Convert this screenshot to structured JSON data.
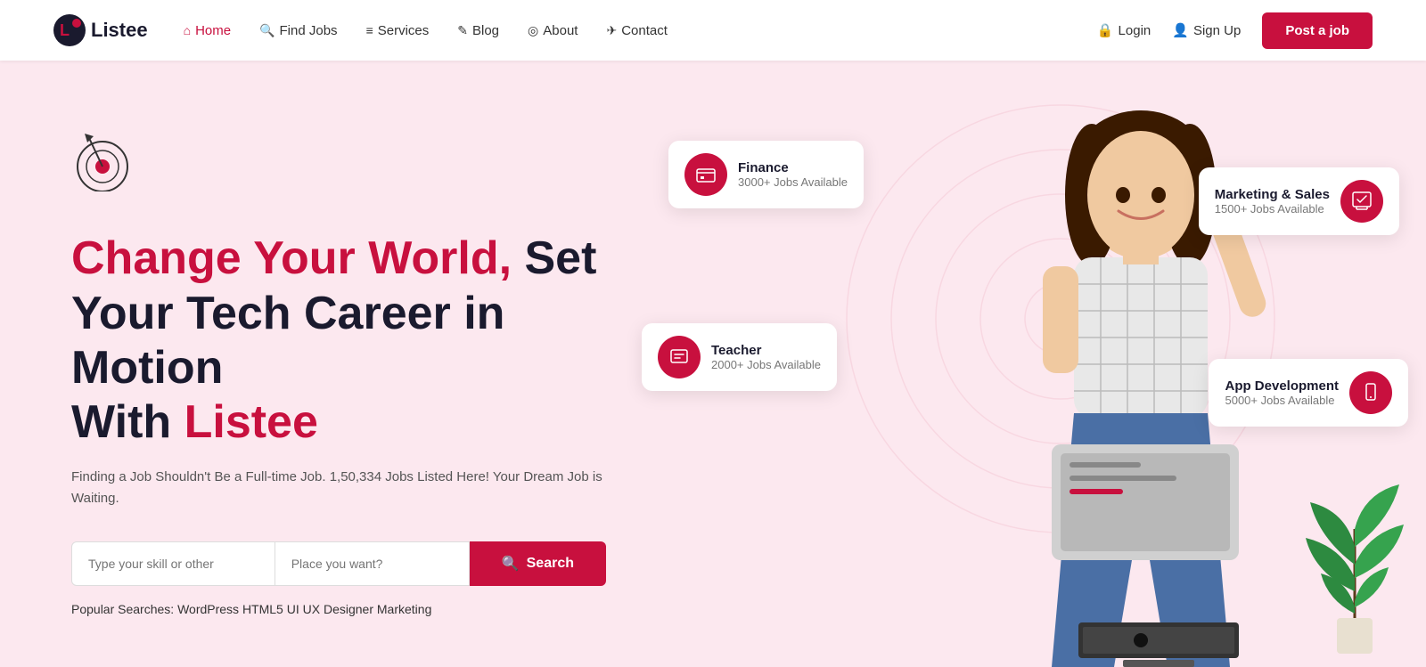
{
  "brand": {
    "name": "Listee"
  },
  "nav": {
    "links": [
      {
        "id": "home",
        "label": "Home",
        "active": true,
        "icon": "⌂"
      },
      {
        "id": "find-jobs",
        "label": "Find Jobs",
        "active": false,
        "icon": "🔍"
      },
      {
        "id": "services",
        "label": "Services",
        "active": false,
        "icon": "≡"
      },
      {
        "id": "blog",
        "label": "Blog",
        "active": false,
        "icon": "✎"
      },
      {
        "id": "about",
        "label": "About",
        "active": false,
        "icon": "◎"
      },
      {
        "id": "contact",
        "label": "Contact",
        "active": false,
        "icon": "✈"
      }
    ],
    "login_label": "Login",
    "signup_label": "Sign Up",
    "post_job_label": "Post a job"
  },
  "hero": {
    "title_red": "Change Your World,",
    "title_black": " Set Your Tech Career in Motion With ",
    "title_red2": "Listee",
    "subtitle": "Finding a Job Shouldn't Be a Full-time Job. 1,50,334 Jobs Listed Here! Your Dream Job is Waiting.",
    "search": {
      "skill_placeholder": "Type your skill or other",
      "place_placeholder": "Place you want?",
      "button_label": "Search"
    },
    "popular": {
      "label": "Popular Searches:",
      "terms": "WordPress  HTML5  UI  UX  Designer  Marketing"
    }
  },
  "job_cards": [
    {
      "id": "finance",
      "title": "Finance",
      "count": "3000+ Jobs Available",
      "icon": "💼"
    },
    {
      "id": "marketing-sales",
      "title": "Marketing & Sales",
      "count": "1500+ Jobs Available",
      "icon": "📊"
    },
    {
      "id": "teacher",
      "title": "Teacher",
      "count": "2000+ Jobs Available",
      "icon": "📚"
    },
    {
      "id": "app-development",
      "title": "App Development",
      "count": "5000+ Jobs Available",
      "icon": "📱"
    }
  ],
  "colors": {
    "primary": "#c8103e",
    "dark": "#1a1a2e",
    "bg": "#fce8ef"
  }
}
